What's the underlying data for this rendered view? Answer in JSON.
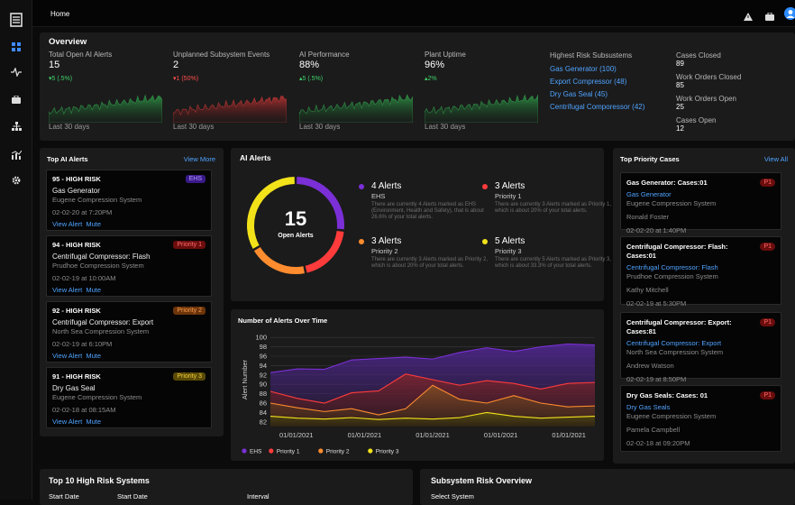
{
  "topbar": {
    "title": "Home"
  },
  "overview": {
    "title": "Overview",
    "metrics": [
      {
        "label": "Total Open AI Alerts",
        "value": "15",
        "delta": "▾5 (.5%)",
        "delta_color": "#3fd06a",
        "foot": "Last 30 days",
        "spark": "green"
      },
      {
        "label": "Unplanned Subsystem Events",
        "value": "2",
        "delta": "▾1 (50%)",
        "delta_color": "#ff4d4d",
        "foot": "Last 30 days",
        "spark": "red"
      },
      {
        "label": "AI Performance",
        "value": "88%",
        "delta": "▴5 (.5%)",
        "delta_color": "#3fd06a",
        "foot": "Last 30 days",
        "spark": "green"
      },
      {
        "label": "Plant Uptime",
        "value": "96%",
        "delta": "▴2%",
        "delta_color": "#3fd06a",
        "foot": "Last 30 days",
        "spark": "green"
      }
    ],
    "risk": {
      "label": "Highest Risk Subsustems",
      "items": [
        "Gas Generator (100)",
        "Export Compressor (48)",
        "Dry Gas Seal (45)",
        "Centrifugal Comporessor (42)"
      ]
    },
    "cases": [
      {
        "label": "Cases Closed",
        "value": "89"
      },
      {
        "label": "Work Orders Closed",
        "value": "85"
      },
      {
        "label": "Work Orders Open",
        "value": "25"
      },
      {
        "label": "Cases Open",
        "value": "12"
      }
    ]
  },
  "top_alerts": {
    "title": "Top AI Alerts",
    "view_more": "View More",
    "cards": [
      {
        "risk": "95 - HIGH RISK",
        "badge": "EHS",
        "badge_bg": "#3a1a8a",
        "badge_fg": "#b69bff",
        "name": "Gas Generator",
        "system": "Eugene Compression System",
        "date": "02-02-20 at 7:20PM",
        "view": "View Alert",
        "mute": "Mute"
      },
      {
        "risk": "94 - HIGH RISK",
        "badge": "Priority 1",
        "badge_bg": "#6b0d0d",
        "badge_fg": "#ff6b6b",
        "name": "Centrifugal Compressor: Flash",
        "system": "Prudhoe Compression System",
        "date": "02-02-19 at 10:00AM",
        "view": "View Alert",
        "mute": "Mute"
      },
      {
        "risk": "92 - HIGH RISK",
        "badge": "Priority 2",
        "badge_bg": "#6b340a",
        "badge_fg": "#ff9d4d",
        "name": "Centrifugal Compressor: Export",
        "system": "North Sea Compression System",
        "date": "02-02-19 at 6:10PM",
        "view": "View Alert",
        "mute": "Mute"
      },
      {
        "risk": "91 - HIGH RISK",
        "badge": "Priority 3",
        "badge_bg": "#5a4a06",
        "badge_fg": "#f2d03a",
        "name": "Dry Gas Seal",
        "system": "Eugene Compression System",
        "date": "02-02-18 at 08:15AM",
        "view": "View Alert",
        "mute": "Mute"
      }
    ]
  },
  "ai_alerts": {
    "title": "AI Alerts",
    "total": "15",
    "total_label": "Open Alerts",
    "segments": [
      {
        "name": "EHS",
        "value": 4,
        "color": "#7b2fd6"
      },
      {
        "name": "Priority 1",
        "value": 3,
        "color": "#ff3b3b"
      },
      {
        "name": "Priority 2",
        "value": 3,
        "color": "#ff8c2e"
      },
      {
        "name": "Priority 3",
        "value": 5,
        "color": "#f2e21a"
      }
    ],
    "legend": [
      {
        "count": "4 Alerts",
        "kind": "EHS",
        "desc": "There are currently 4 Alerts marked as EHS (Environment, Health and Safety), that is about 26.6% of your total alerts.",
        "color": "#7b2fd6"
      },
      {
        "count": "3 Alerts",
        "kind": "Priority 1",
        "desc": "There are currently 3 Alerts marked as Priority 1, which is about 20% of your total alerts.",
        "color": "#ff3b3b"
      },
      {
        "count": "3 Alerts",
        "kind": "Priority 2",
        "desc": "There are currently 3 Alerts marked as Priority 2, which is about 20% of your total alerts.",
        "color": "#ff8c2e"
      },
      {
        "count": "5 Alerts",
        "kind": "Priority 3",
        "desc": "There are currently 5 Alerts marked as Priority 3, which is about 33.3% of your total alerts.",
        "color": "#f2e21a"
      }
    ]
  },
  "chart_data": {
    "type": "area",
    "title": "Number of Alerts Over Time",
    "ylabel": "Alert Number",
    "xlabel": "",
    "ylim": [
      81,
      101
    ],
    "yticks": [
      82,
      84,
      86,
      88,
      90,
      92,
      94,
      96,
      98,
      100
    ],
    "xticks": [
      "01/01/2021",
      "01/01/2021",
      "01/01/2021",
      "01/01/2021",
      "01/01/2021"
    ],
    "grid": true,
    "legend_position": "bottom",
    "x": [
      0,
      1,
      2,
      3,
      4,
      5,
      6,
      7,
      8,
      9,
      10,
      11,
      12
    ],
    "series": [
      {
        "name": "EHS",
        "color": "#7b2fd6",
        "values": [
          92.5,
          93.3,
          93.2,
          95.2,
          95.5,
          95.8,
          95.4,
          96.8,
          97.8,
          97.0,
          98.0,
          98.6,
          98.4
        ]
      },
      {
        "name": "Priority 1",
        "color": "#ff3b3b",
        "values": [
          88.5,
          87.0,
          86.0,
          88.2,
          88.6,
          92.2,
          91.0,
          89.8,
          90.8,
          90.2,
          89.0,
          90.2,
          90.4
        ]
      },
      {
        "name": "Priority 2",
        "color": "#ff8c2e",
        "values": [
          86.0,
          85.0,
          84.2,
          84.8,
          83.5,
          84.8,
          89.8,
          86.8,
          86.0,
          87.6,
          86.0,
          85.2,
          85.4
        ]
      },
      {
        "name": "Priority 3",
        "color": "#f2e21a",
        "values": [
          83.2,
          82.8,
          82.6,
          82.9,
          82.5,
          82.8,
          82.6,
          82.9,
          84.0,
          83.2,
          82.8,
          83.0,
          83.2
        ]
      }
    ]
  },
  "priority_cases": {
    "title": "Top Priority Cases",
    "view_all": "View All",
    "cards": [
      {
        "title": "Gas Generator: Cases:01",
        "badge": "P1",
        "link": "Gas Generator",
        "system": "Eugene Compression System",
        "person": "Ronald Foster",
        "date": "02-02-20 at 1:40PM"
      },
      {
        "title": "Centrifugal Compressor: Flash: Cases:01",
        "badge": "P1",
        "link": "Centrifugal Compressor: Flash",
        "system": "Prudhoe Compression System",
        "person": "Kathy Mitchell",
        "date": "02-02-19 at 5:30PM"
      },
      {
        "title": "Centrifugal Compressor: Export: Cases:81",
        "badge": "P1",
        "link": "Centrifugal Compressor: Export",
        "system": "North Sea Compression System",
        "person": "Andrew Watson",
        "date": "02-02-19 at 8:50PM"
      },
      {
        "title": "Dry Gas Seals: Cases: 01",
        "badge": "P1",
        "link": "Dry Gas Seals",
        "system": "Eugene Compression System",
        "person": "Pamela Campbell",
        "date": "02-02-18 at 09:20PM"
      }
    ]
  },
  "bottom": {
    "left_title": "Top 10 High Risk Systems",
    "start_date_1": "Start Date",
    "start_date_2": "Start Date",
    "interval": "Interval",
    "right_title": "Subsystem Risk Overview",
    "select_system": "Select System"
  },
  "colors": {
    "accent": "#4fa3ff",
    "panel": "#1b1b1b",
    "positive": "#3fd06a",
    "negative": "#ff4d4d"
  }
}
